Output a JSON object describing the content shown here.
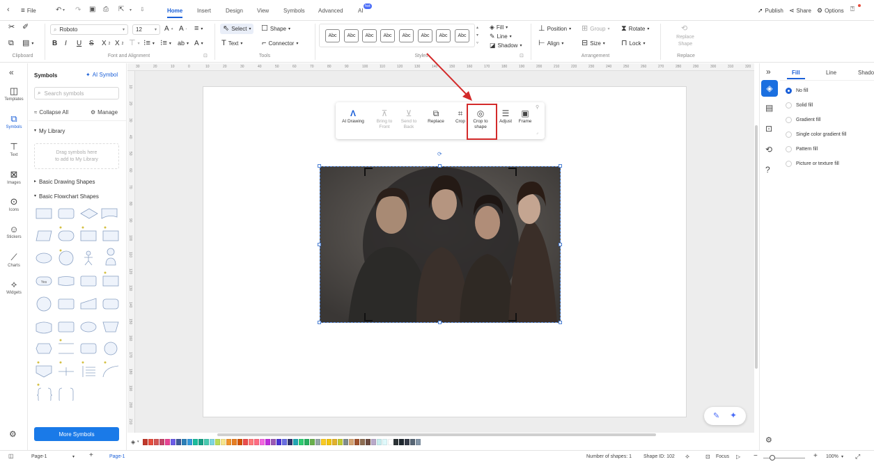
{
  "topbar": {
    "file_label": "File",
    "tabs": [
      "Home",
      "Insert",
      "Design",
      "View",
      "Symbols",
      "Advanced",
      "AI"
    ],
    "ai_badge": "hot",
    "publish_label": "Publish",
    "share_label": "Share",
    "options_label": "Options"
  },
  "ribbon": {
    "font_name": "Roboto",
    "font_size": "12",
    "select_label": "Select",
    "shape_label": "Shape",
    "text_label": "Text",
    "connector_label": "Connector",
    "style_sample": "Abc",
    "fill_label": "Fill",
    "line_label": "Line",
    "shadow_label": "Shadow",
    "position_label": "Position",
    "group_label": "Group",
    "rotate_label": "Rotate",
    "align_label": "Align",
    "size_label": "Size",
    "lock_label": "Lock",
    "replace_shape_label": "Replace Shape",
    "groups": {
      "clipboard": "Clipboard",
      "font": "Font and Alignment",
      "tools": "Tools",
      "styles": "Styles",
      "arrangement": "Arrangement",
      "replace": "Replace"
    }
  },
  "rail": [
    {
      "label": "Templates",
      "icon": "templates-icon"
    },
    {
      "label": "Symbols",
      "icon": "symbols-icon"
    },
    {
      "label": "Text",
      "icon": "text-icon"
    },
    {
      "label": "Images",
      "icon": "images-icon"
    },
    {
      "label": "Icons",
      "icon": "icons-icon"
    },
    {
      "label": "Stickers",
      "icon": "stickers-icon"
    },
    {
      "label": "Charts",
      "icon": "charts-icon"
    },
    {
      "label": "Widgets",
      "icon": "widgets-icon"
    }
  ],
  "symbols": {
    "title": "Symbols",
    "ai_symbol": "AI Symbol",
    "search_placeholder": "Search symbols",
    "collapse_all": "Collapse All",
    "manage": "Manage",
    "my_library": "My Library",
    "drag_hint_1": "Drag symbols here",
    "drag_hint_2": "to add to My Library",
    "basic_drawing": "Basic Drawing Shapes",
    "basic_flowchart": "Basic Flowchart Shapes",
    "yes_label": "Yes",
    "more_symbols": "More Symbols"
  },
  "ruler": {
    "h": [
      "30",
      "20",
      "10",
      "0",
      "10",
      "20",
      "30",
      "40",
      "50",
      "60",
      "70",
      "80",
      "90",
      "100",
      "110",
      "120",
      "130",
      "140",
      "150",
      "160",
      "170",
      "180",
      "190",
      "200",
      "210",
      "220",
      "230",
      "240",
      "250",
      "260",
      "270",
      "280",
      "290",
      "300",
      "310",
      "320"
    ],
    "v": [
      "10",
      "20",
      "30",
      "40",
      "50",
      "60",
      "70",
      "80",
      "90",
      "100",
      "110",
      "120",
      "130",
      "140",
      "150",
      "160",
      "170",
      "180",
      "190",
      "200",
      "210"
    ]
  },
  "popup": {
    "ai_drawing": "AI Drawing",
    "bring_front_1": "Bring to",
    "bring_front_2": "Front",
    "send_back_1": "Send to",
    "send_back_2": "Back",
    "replace": "Replace",
    "crop": "Crop",
    "crop_shape_1": "Crop to",
    "crop_shape_2": "shape",
    "adjust": "Adjust",
    "frame": "Frame"
  },
  "right_panel": {
    "tabs": [
      "Fill",
      "Line",
      "Shadow"
    ],
    "options": [
      "No fill",
      "Solid fill",
      "Gradient fill",
      "Single color gradient fill",
      "Pattern fill",
      "Picture or texture fill"
    ],
    "selected_option": "No fill"
  },
  "status": {
    "page_select": "Page-1",
    "page_tab": "Page-1",
    "num_shapes": "Number of shapes: 1",
    "shape_id": "Shape ID: 102",
    "focus": "Focus",
    "zoom": "100%"
  },
  "colors": {
    "accent": "#1a5fd8",
    "highlight": "#d32a2a"
  },
  "palette": [
    "#c0392b",
    "#e74c3c",
    "#d35454",
    "#c44569",
    "#e84393",
    "#6c5ce7",
    "#3d5a99",
    "#2c7fb8",
    "#3498db",
    "#1abc9c",
    "#16a085",
    "#48c9b0",
    "#7ed6df",
    "#badc58",
    "#f6e58d",
    "#f0932b",
    "#e67e22",
    "#d35400",
    "#eb4d4b",
    "#ff7979",
    "#ff6b81",
    "#f368e0",
    "#be2edd",
    "#9b59b6",
    "#4834d4",
    "#686de0",
    "#30336b",
    "#22a6b3",
    "#2ecc71",
    "#27ae60",
    "#6ab04c",
    "#95a5a6",
    "#f9ca24",
    "#f1c40f",
    "#e1b12c",
    "#c0ca33",
    "#7f8c8d",
    "#d4a373",
    "#a0522d",
    "#8e6e53",
    "#6d4c41",
    "#b8a9c9",
    "#c7ecee",
    "#dff9fb",
    "#ffffff",
    "#2d3436",
    "#1e272e",
    "#353b48",
    "#576574",
    "#8395a7"
  ]
}
